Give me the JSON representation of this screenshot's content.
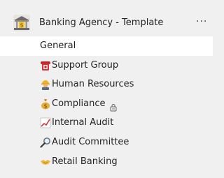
{
  "team": {
    "name": "Banking Agency - Template",
    "icon": "bank-building-icon",
    "more": "···"
  },
  "channels": [
    {
      "label": "General",
      "icon": ""
    },
    {
      "label": "Support Group",
      "icon": "telephone-icon"
    },
    {
      "label": "Human Resources",
      "icon": "construction-worker-icon"
    },
    {
      "label": "Compliance",
      "icon": "money-bag-icon",
      "private": true
    },
    {
      "label": "Internal Audit",
      "icon": "chart-increasing-icon"
    },
    {
      "label": "Audit Committee",
      "icon": "magnifying-glass-icon"
    },
    {
      "label": "Retail Banking",
      "icon": "handshake-icon"
    }
  ],
  "colors": {
    "panel_background": "#f0f0f0",
    "selected_background": "#ffffff",
    "text": "#252423"
  }
}
